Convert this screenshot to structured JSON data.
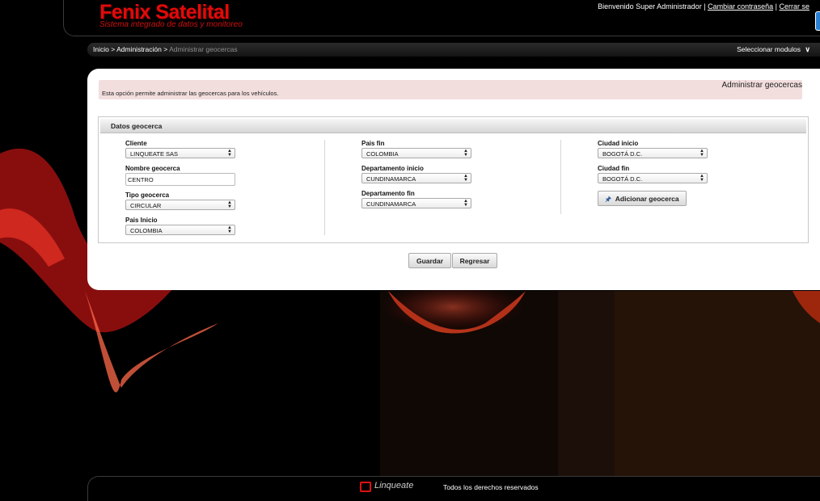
{
  "header": {
    "brand_title": "Fenix Satelital",
    "brand_subtitle": "Sistema integrado de datos y monitoreo",
    "welcome_text": "Bienvenido Super Administrador",
    "separator": "|",
    "change_password_link": "Cambiar contraseña",
    "logout_link": "Cerrar se"
  },
  "breadcrumb": {
    "home": "Inicio",
    "sep": ">",
    "admin": "Administración",
    "current": "Administrar geocercas",
    "module_selector": "Seleccionar modulos",
    "module_selector_icon": "chevron-down-icon"
  },
  "info": {
    "title": "Administrar geocercas",
    "description": "Esta opción permite administrar las geocercas para los vehículos."
  },
  "form": {
    "section_title": "Datos geocerca",
    "cliente": {
      "label": "Cliente",
      "value": "LINQUEATE SAS"
    },
    "nombre": {
      "label": "Nombre geocerca",
      "value": "CENTRO"
    },
    "tipo": {
      "label": "Tipo geocerca",
      "value": "CIRCULAR"
    },
    "pais_inicio": {
      "label": "Pais Inicio",
      "value": "COLOMBIA"
    },
    "pais_fin": {
      "label": "Pais fin",
      "value": "COLOMBIA"
    },
    "depto_inicio": {
      "label": "Departamento inicio",
      "value": "CUNDINAMARCA"
    },
    "depto_fin": {
      "label": "Departamento fin",
      "value": "CUNDINAMARCA"
    },
    "ciudad_inicio": {
      "label": "Ciudad inicio",
      "value": "BOGOTÁ D.C."
    },
    "ciudad_fin": {
      "label": "Ciudad fin",
      "value": "BOGOTÁ D.C."
    },
    "add_button": "Adicionar geocerca",
    "add_button_icon": "pin-icon"
  },
  "actions": {
    "save": "Guardar",
    "back": "Regresar"
  },
  "footer": {
    "logo_text": "Linqueate",
    "rights": "Todos los derechos reservados"
  },
  "colors": {
    "brand_red": "#e10a0a",
    "info_bg": "#f3dede"
  }
}
